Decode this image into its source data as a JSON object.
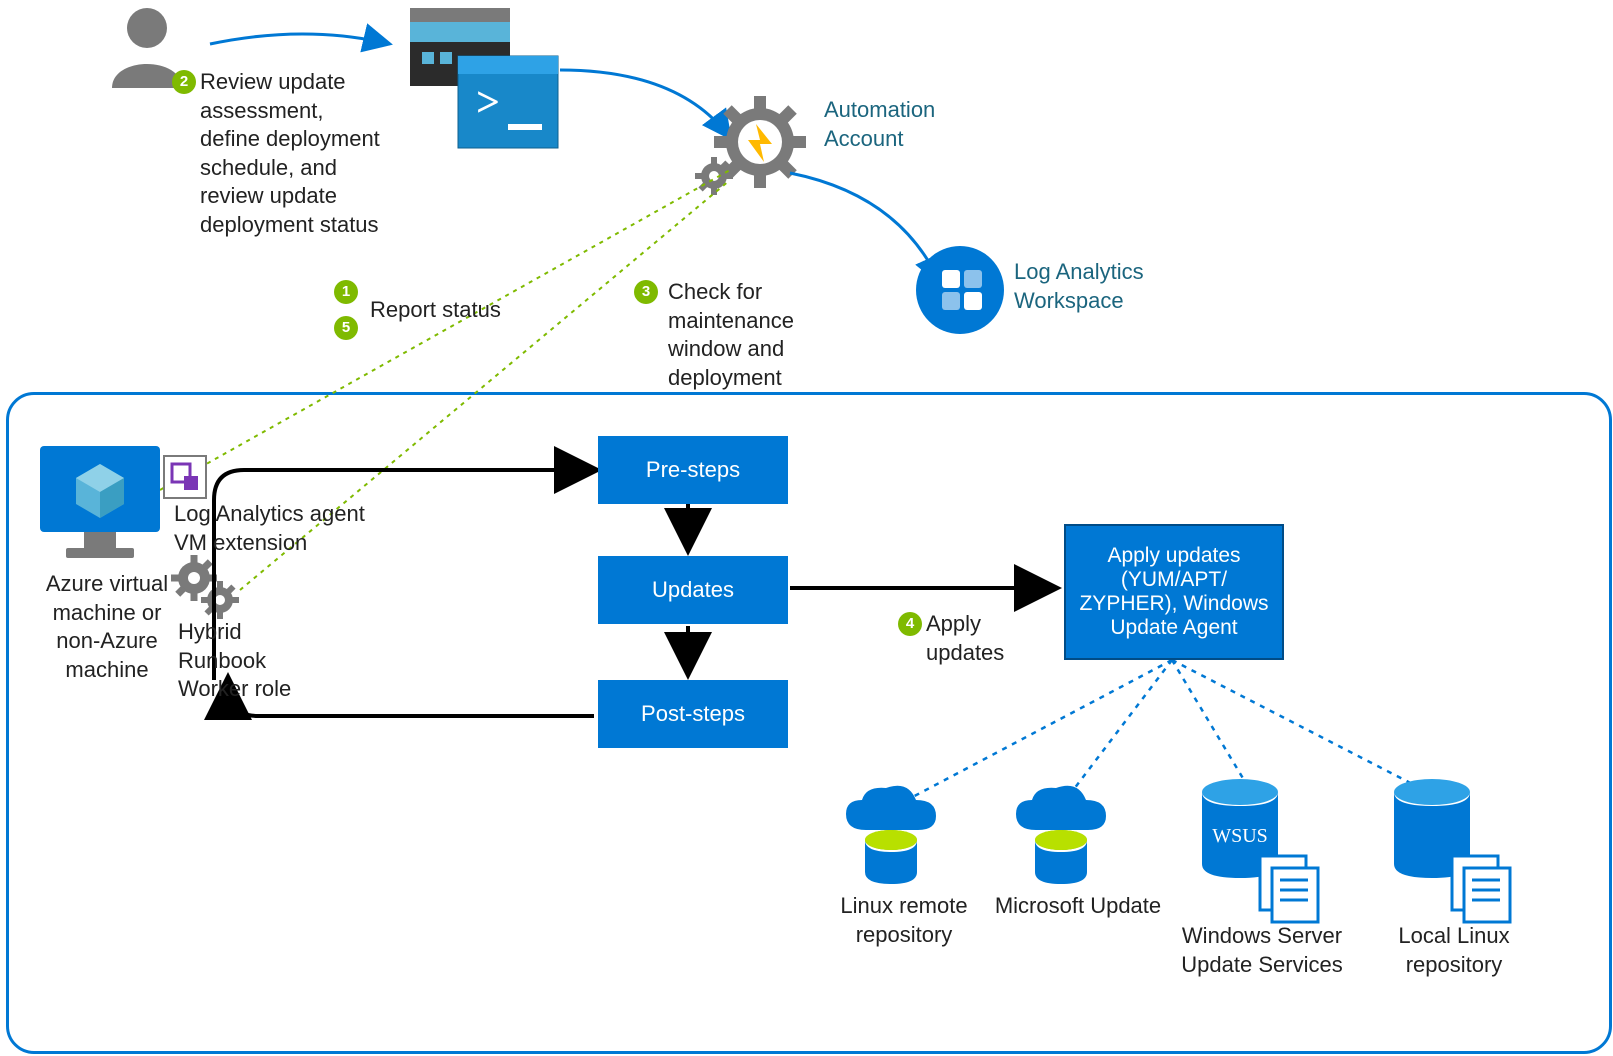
{
  "labels": {
    "step2": "Review update assessment, define deployment schedule, and review update deployment status",
    "step1_5": "Report status",
    "step3": "Check for maintenance window and deployment",
    "automation_account": "Automation Account",
    "log_analytics_ws": "Log Analytics Workspace",
    "azure_vm": "Azure virtual machine or non-Azure machine",
    "la_agent_ext": "Log Analytics agent VM extension",
    "hybrid_worker": "Hybrid Runbook Worker role",
    "pre_steps": "Pre-steps",
    "updates": "Updates",
    "post_steps": "Post-steps",
    "apply_updates_label": "Apply updates",
    "apply_box": "Apply updates (YUM/APT/ ZYPHER), Windows Update Agent",
    "linux_remote": "Linux remote repository",
    "ms_update": "Microsoft Update",
    "wsus": "Windows Server Update Services",
    "wsus_box": "WSUS",
    "local_linux": "Local Linux repository"
  },
  "badges": {
    "b1": "1",
    "b2": "2",
    "b3": "3",
    "b4": "4",
    "b5": "5"
  },
  "colors": {
    "azure_blue": "#0078d4",
    "deep_blue": "#004c87",
    "green": "#7fba00",
    "gold": "#ffb900",
    "gray": "#7a7a7a"
  }
}
